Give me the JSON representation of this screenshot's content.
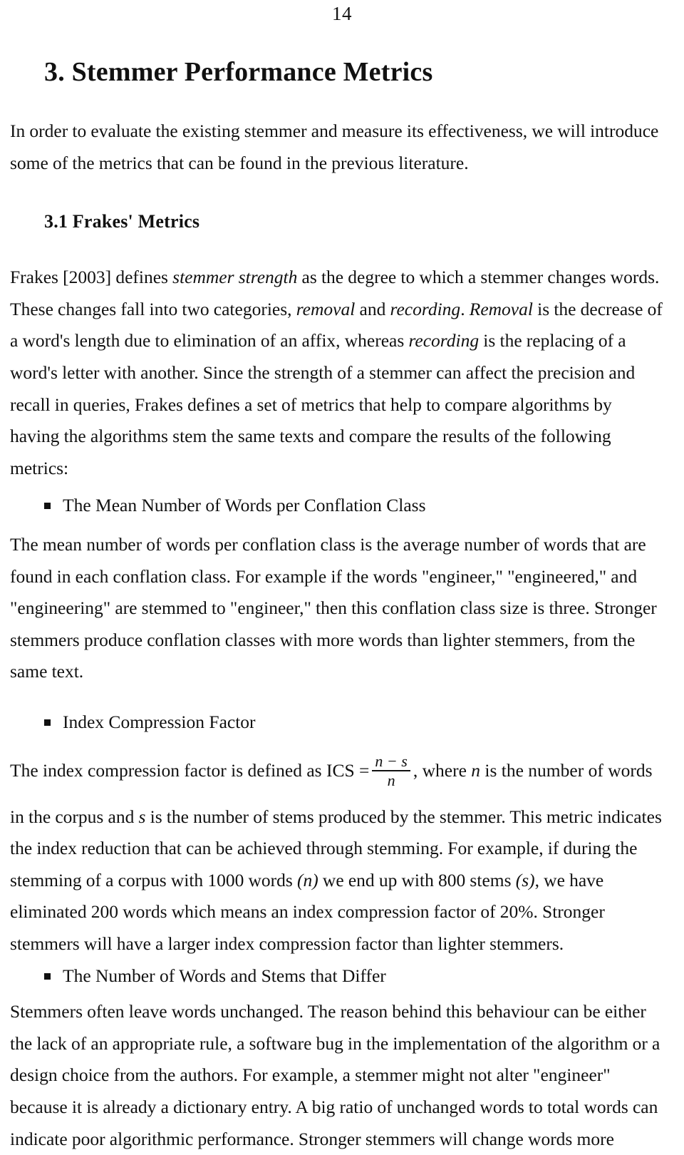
{
  "page": {
    "number": "14"
  },
  "headings": {
    "section": "3. Stemmer Performance Metrics",
    "subsection": "3.1 Frakes' Metrics"
  },
  "paragraphs": {
    "intro": "In order to evaluate the existing stemmer and measure its effectiveness, we will introduce some of the metrics that can be found in the previous literature.",
    "frakes_p1_a": "Frakes [2003] defines ",
    "frakes_p1_em1": "stemmer strength",
    "frakes_p1_b": " as the degree to which a stemmer changes words. These changes fall into two categories, ",
    "frakes_p1_em2": "removal",
    "frakes_p1_c": " and ",
    "frakes_p1_em3": "recording",
    "frakes_p1_d": ". ",
    "frakes_p1_em4": "Removal",
    "frakes_p1_e": " is the decrease of a word's length due to elimination of an affix, whereas ",
    "frakes_p1_em5": "recording",
    "frakes_p1_f": " is the replacing of a word's letter with another. Since the strength of a stemmer can affect the precision and recall in queries, Frakes defines a set of metrics that help to compare algorithms by having the algorithms stem the same texts and compare the results of the following metrics:",
    "mean_words_body": "The mean number of words per conflation class is the average number of words that are found in each conflation class. For example if the words \"engineer,\" \"engineered,\"  and \"engineering\" are stemmed to \"engineer,\" then this conflation class size is three. Stronger  stemmers produce conflation classes with more words than lighter stemmers, from the same text.",
    "icf_tail_a": ", where ",
    "icf_tail_n": "n",
    "icf_tail_b": " is the number of words",
    "icf_body_a": "in the corpus and ",
    "icf_body_s": "s",
    "icf_body_b": " is the number of stems produced by the stemmer. This metric indicates the index reduction that can be achieved through stemming. For example, if during the stemming of a corpus with 1000 words ",
    "icf_body_n_paren": "(n)",
    "icf_body_c": " we end up with 800 stems ",
    "icf_body_s_paren": "(s)",
    "icf_body_d": ", we have eliminated 200 words which means an index compression factor of 20%. Stronger stemmers will have a larger index compression factor than lighter stemmers.",
    "differ_body": "Stemmers often leave words unchanged. The reason behind this behaviour can be either the lack of an appropriate rule, a software bug in the implementation of the algorithm or a design choice from the authors.  For example, a stemmer might not alter \"engineer\" because it is already a dictionary entry. A big ratio of unchanged words to total words can indicate poor algorithmic performance. Stronger stemmers will change words more"
  },
  "bullets": {
    "mean_words": "The Mean Number of Words per Conflation Class",
    "index_compression": "Index Compression Factor",
    "words_stems_differ": "The Number of  Words and Stems that Differ"
  },
  "formula": {
    "lead_in": "The index compression factor is defined as ICS =",
    "label": "ICS",
    "numerator": "n − s",
    "denominator": "n"
  },
  "colors": {
    "text": "#111111",
    "background": "#ffffff"
  }
}
